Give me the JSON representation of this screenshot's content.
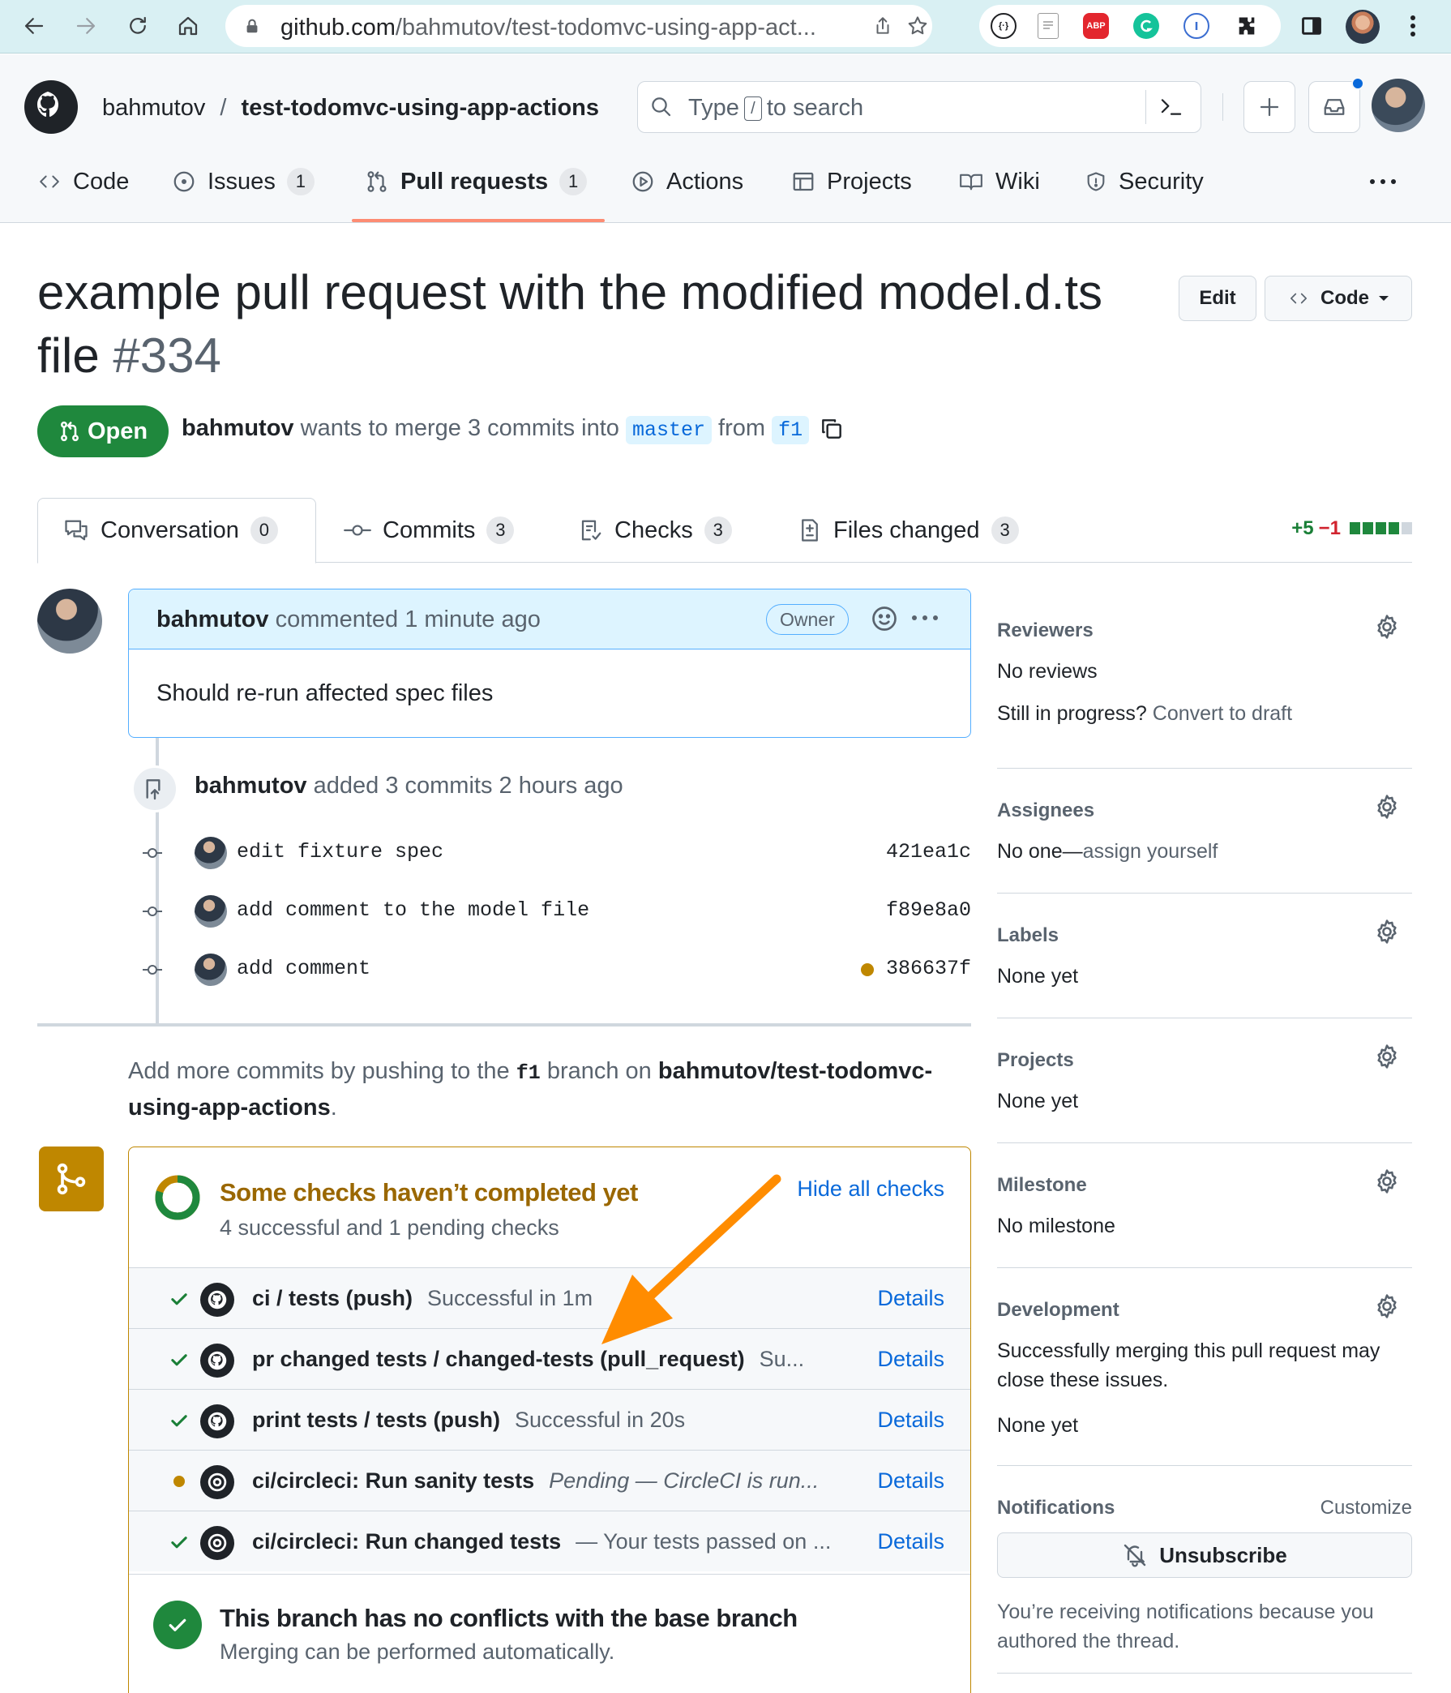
{
  "browser": {
    "url_host": "github.com",
    "url_path": "/bahmutov/test-todomvc-using-app-act...",
    "extensions": [
      "devtools-icon",
      "notes-icon",
      "adblock-icon",
      "grammarly-icon",
      "password-icon",
      "puzzle-icon",
      "sidebar-icon",
      "profile-avatar"
    ],
    "abp_label": "ABP"
  },
  "header": {
    "owner": "bahmutov",
    "separator": "/",
    "repo": "test-todomvc-using-app-actions",
    "search_before": "Type",
    "search_key": "/",
    "search_after": "to search"
  },
  "repo_tabs": [
    {
      "label": "Code"
    },
    {
      "label": "Issues",
      "count": "1"
    },
    {
      "label": "Pull requests",
      "count": "1",
      "selected": true
    },
    {
      "label": "Actions"
    },
    {
      "label": "Projects"
    },
    {
      "label": "Wiki"
    },
    {
      "label": "Security"
    }
  ],
  "pr": {
    "title": "example pull request with the modified model.d.ts file",
    "number": "#334",
    "state": "Open",
    "edit_label": "Edit",
    "code_label": "Code",
    "author": "bahmutov",
    "merge_text": "wants to merge 3 commits into",
    "base_branch": "master",
    "from_text": "from",
    "head_branch": "f1"
  },
  "pr_tabs": [
    {
      "label": "Conversation",
      "count": "0"
    },
    {
      "label": "Commits",
      "count": "3"
    },
    {
      "label": "Checks",
      "count": "3"
    },
    {
      "label": "Files changed",
      "count": "3"
    }
  ],
  "diffstat": {
    "added": "+5",
    "removed": "−1",
    "blocks": [
      "added",
      "added",
      "added",
      "added",
      "neutral"
    ]
  },
  "comment": {
    "author": "bahmutov",
    "action": "commented 1 minute ago",
    "badge": "Owner",
    "body": "Should re-run affected spec files"
  },
  "commit_event": {
    "author": "bahmutov",
    "text": "added 3 commits 2 hours ago"
  },
  "commits": [
    {
      "message": "edit fixture spec",
      "sha": "421ea1c",
      "pending": false
    },
    {
      "message": "add comment to the model file",
      "sha": "f89e8a0",
      "pending": false
    },
    {
      "message": "add comment",
      "sha": "386637f",
      "pending": true
    }
  ],
  "push_hint": {
    "before": "Add more commits by pushing to the",
    "branch": "f1",
    "middle": "branch on",
    "repo": "bahmutov/test-todomvc-using-app-actions",
    "end": "."
  },
  "checks": {
    "title": "Some checks haven’t completed yet",
    "subtitle": "4 successful and 1 pending checks",
    "hide_label": "Hide all checks",
    "completed_fraction": 0.8,
    "items": [
      {
        "name": "ci / tests (push)",
        "desc": "Successful in 1m",
        "status": "success",
        "provider": "github",
        "details": "Details",
        "italic": false
      },
      {
        "name": "pr changed tests / changed-tests (pull_request)",
        "desc": "Su...",
        "status": "success",
        "provider": "github",
        "details": "Details",
        "italic": false
      },
      {
        "name": "print tests / tests (push)",
        "desc": "Successful in 20s",
        "status": "success",
        "provider": "github",
        "details": "Details",
        "italic": false
      },
      {
        "name": "ci/circleci: Run sanity tests",
        "desc": "Pending — CircleCI is run...",
        "status": "pending",
        "provider": "circleci",
        "details": "Details",
        "italic": true
      },
      {
        "name": "ci/circleci: Run changed tests",
        "desc": "— Your tests passed on ...",
        "status": "success",
        "provider": "circleci",
        "details": "Details",
        "italic": false
      }
    ],
    "no_conflicts_title": "This branch has no conflicts with the base branch",
    "no_conflicts_sub": "Merging can be performed automatically."
  },
  "sidebar": {
    "reviewers": {
      "title": "Reviewers",
      "line1": "No reviews",
      "line2_muted": "Still in progress?",
      "line2_link": "Convert to draft"
    },
    "assignees": {
      "title": "Assignees",
      "line1_a": "No one—",
      "line1_b": "assign yourself"
    },
    "labels": {
      "title": "Labels",
      "line1": "None yet"
    },
    "projects": {
      "title": "Projects",
      "line1": "None yet"
    },
    "milestone": {
      "title": "Milestone",
      "line1": "No milestone"
    },
    "development": {
      "title": "Development",
      "line1": "Successfully merging this pull request may",
      "line2": "close these issues.",
      "line3": "None yet"
    },
    "notifications": {
      "title": "Notifications",
      "customize": "Customize",
      "unsubscribe": "Unsubscribe",
      "note1": "You’re receiving notifications because you",
      "note2": "authored the thread."
    }
  },
  "colors": {
    "accent": "#0969da",
    "open": "#1f883d",
    "pending": "#bf8700",
    "tab_underline": "#fd8c73",
    "annotation_arrow": "#ff8c00"
  }
}
